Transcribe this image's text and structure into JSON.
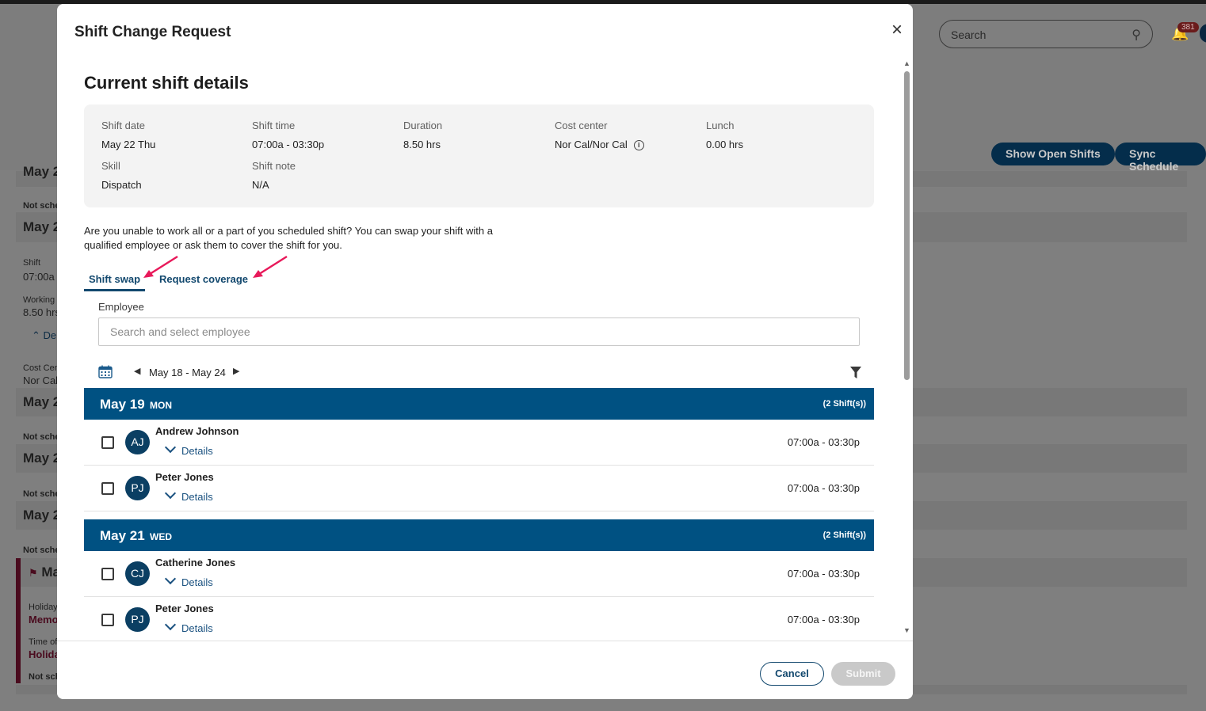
{
  "background": {
    "search_placeholder": "Search",
    "notification_count": "381",
    "buttons": {
      "show_open_shifts": "Show Open Shifts",
      "sync_schedule": "Sync Schedule"
    },
    "left_panel": [
      {
        "text": "May 2"
      },
      {
        "text": "Not sche"
      },
      {
        "text": "May 2"
      },
      {
        "text": "Shift"
      },
      {
        "text": "07:00a"
      },
      {
        "text": "Working"
      },
      {
        "text": "8.50 hrs"
      },
      {
        "text": "De"
      },
      {
        "text": "Cost Cen"
      },
      {
        "text": "Nor Cal"
      },
      {
        "text": "May 2"
      },
      {
        "text": "Not sche"
      },
      {
        "text": "May 2"
      },
      {
        "text": "Not sche"
      },
      {
        "text": "May 2"
      },
      {
        "text": "Not sche"
      },
      {
        "text": "Ma"
      },
      {
        "text": "Holiday"
      },
      {
        "text": "Memo"
      },
      {
        "text": "Time of"
      },
      {
        "text": "Holida"
      },
      {
        "text": "Not sch"
      }
    ]
  },
  "modal": {
    "title": "Shift Change Request",
    "section_title": "Current shift details",
    "details": {
      "shift_date": {
        "label": "Shift date",
        "value": "May 22 Thu"
      },
      "shift_time": {
        "label": "Shift time",
        "value": "07:00a - 03:30p"
      },
      "duration": {
        "label": "Duration",
        "value": "8.50 hrs"
      },
      "cost_center": {
        "label": "Cost center",
        "value": "Nor Cal/Nor Cal"
      },
      "lunch": {
        "label": "Lunch",
        "value": "0.00 hrs"
      },
      "skill": {
        "label": "Skill",
        "value": "Dispatch"
      },
      "shift_note": {
        "label": "Shift note",
        "value": "N/A"
      }
    },
    "description": "Are you unable to work all or a part of you scheduled shift? You can swap your shift with a qualified employee or ask them to cover the shift for you.",
    "tabs": {
      "swap": "Shift swap",
      "coverage": "Request coverage",
      "active": "swap"
    },
    "employee": {
      "label": "Employee",
      "placeholder": "Search and select employee"
    },
    "week_range": "May 18 - May 24",
    "days": [
      {
        "date": "May 19",
        "dow": "MON",
        "count": "(2 Shift(s))",
        "shifts": [
          {
            "initials": "AJ",
            "name": "Andrew Johnson",
            "details": "Details",
            "time": "07:00a - 03:30p"
          },
          {
            "initials": "PJ",
            "name": "Peter Jones",
            "details": "Details",
            "time": "07:00a - 03:30p"
          }
        ]
      },
      {
        "date": "May 21",
        "dow": "WED",
        "count": "(2 Shift(s))",
        "shifts": [
          {
            "initials": "CJ",
            "name": "Catherine Jones",
            "details": "Details",
            "time": "07:00a - 03:30p"
          },
          {
            "initials": "PJ",
            "name": "Peter Jones",
            "details": "Details",
            "time": "07:00a - 03:30p"
          }
        ]
      }
    ],
    "footer": {
      "cancel": "Cancel",
      "submit": "Submit"
    },
    "colors": {
      "primary": "#005182",
      "accent_annotation": "#e8195a"
    }
  }
}
